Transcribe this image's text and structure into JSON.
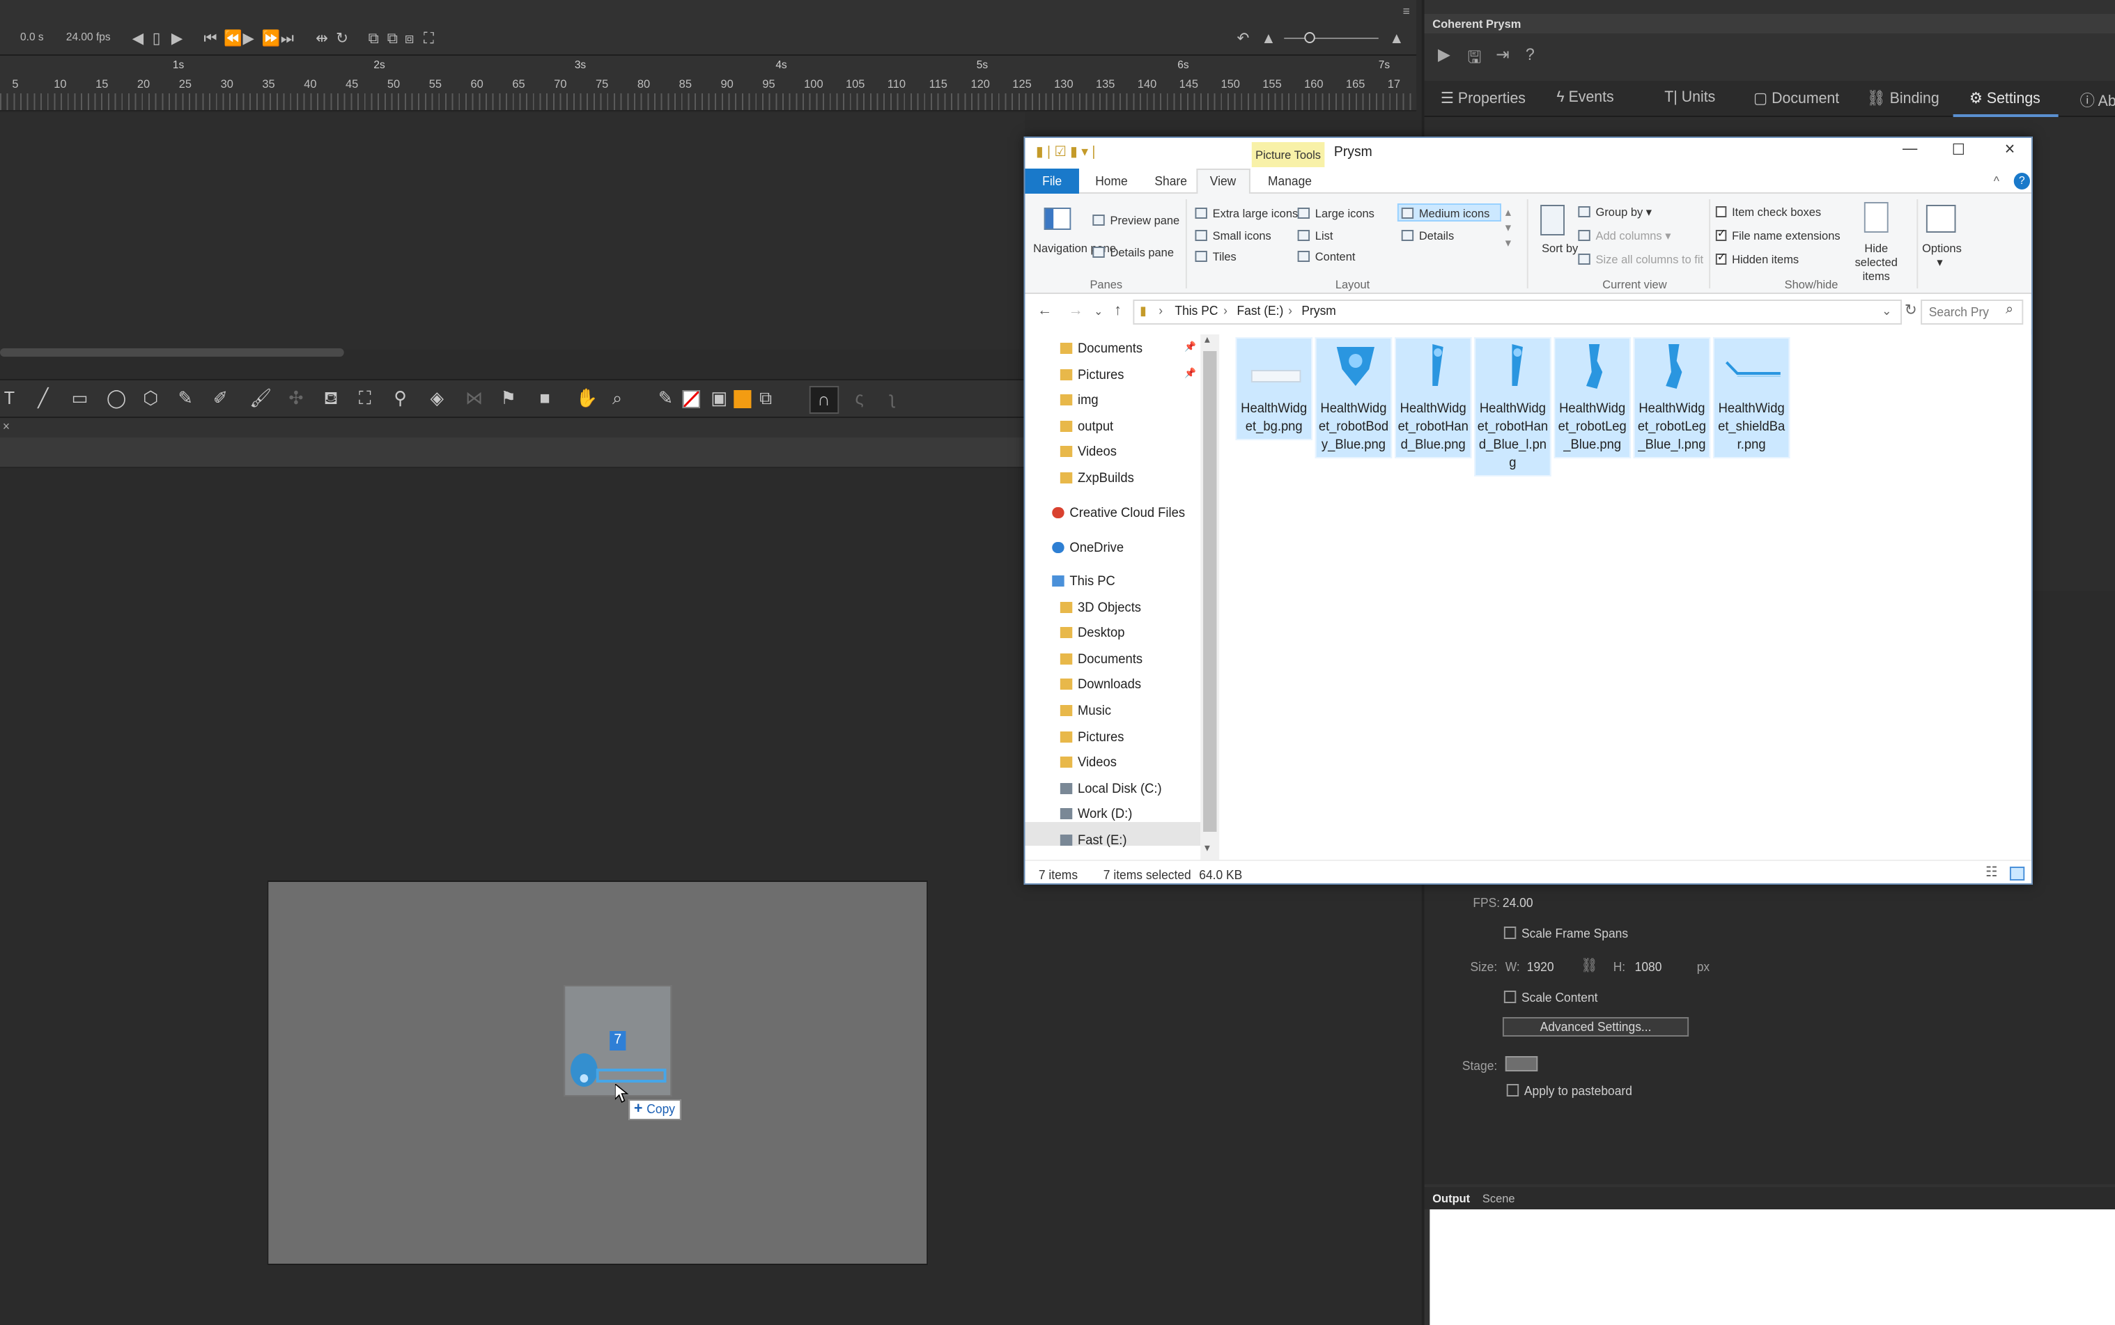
{
  "timeline": {
    "time": "0.0 s",
    "fps": "24.00 fps",
    "seconds": [
      "1s",
      "2s",
      "3s",
      "4s",
      "5s",
      "6s",
      "7s"
    ],
    "frames": [
      "5",
      "10",
      "15",
      "20",
      "25",
      "30",
      "35",
      "40",
      "45",
      "50",
      "55",
      "60",
      "65",
      "70",
      "75",
      "80",
      "85",
      "90",
      "95",
      "100",
      "105",
      "110",
      "115",
      "120",
      "125",
      "130",
      "135",
      "140",
      "145",
      "150",
      "155",
      "160",
      "165",
      "17"
    ]
  },
  "stage": {
    "drag_badge": "7",
    "copy_tooltip": "Copy"
  },
  "right_panel": {
    "title": "Coherent Prysm",
    "tabs": [
      {
        "label": "Properties",
        "icon": "sliders-icon"
      },
      {
        "label": "Events",
        "icon": "lightning-icon"
      },
      {
        "label": "Units",
        "icon": "text-icon"
      },
      {
        "label": "Document",
        "icon": "document-icon"
      },
      {
        "label": "Binding",
        "icon": "link-icon"
      },
      {
        "label": "Settings",
        "icon": "gear-icon"
      },
      {
        "label": "Ab",
        "icon": "info-icon"
      }
    ],
    "active_tab": "Settings",
    "fps_label": "FPS:",
    "fps_value": "24.00",
    "scale_frame_spans": "Scale Frame Spans",
    "size_label": "Size:",
    "w_label": "W:",
    "w_value": "1920",
    "h_label": "H:",
    "h_value": "1080",
    "unit": "px",
    "scale_content": "Scale Content",
    "advanced_button": "Advanced Settings...",
    "stage_label": "Stage:",
    "stage_color": "#6e6e6e",
    "apply_pasteboard": "Apply to pasteboard",
    "output_tabs": [
      "Output",
      "Scene"
    ]
  },
  "explorer": {
    "title": "Prysm",
    "picture_tools": "Picture Tools",
    "tabs": {
      "file": "File",
      "home": "Home",
      "share": "Share",
      "view": "View",
      "manage": "Manage"
    },
    "ribbon": {
      "navigation_pane": "Navigation pane",
      "preview_pane": "Preview pane",
      "details_pane": "Details pane",
      "panes_group": "Panes",
      "layout": [
        "Extra large icons",
        "Large icons",
        "Medium icons",
        "Small icons",
        "List",
        "Details",
        "Tiles",
        "Content"
      ],
      "layout_group": "Layout",
      "sort_by": "Sort by",
      "group_by": "Group by",
      "add_columns": "Add columns",
      "size_columns": "Size all columns to fit",
      "current_view_group": "Current view",
      "item_check_boxes": "Item check boxes",
      "file_name_extensions": "File name extensions",
      "hidden_items": "Hidden items",
      "hide_selected": "Hide selected items",
      "show_hide_group": "Show/hide",
      "options": "Options"
    },
    "breadcrumb": [
      "This PC",
      "Fast (E:)",
      "Prysm"
    ],
    "search_placeholder": "Search Pry",
    "nav_items": [
      {
        "label": "Documents",
        "type": "folder",
        "pinned": true
      },
      {
        "label": "Pictures",
        "type": "folder",
        "pinned": true
      },
      {
        "label": "img",
        "type": "folder"
      },
      {
        "label": "output",
        "type": "folder"
      },
      {
        "label": "Videos",
        "type": "folder"
      },
      {
        "label": "ZxpBuilds",
        "type": "folder"
      },
      {
        "label": "Creative Cloud Files",
        "type": "cloud"
      },
      {
        "label": "OneDrive",
        "type": "onedrive"
      },
      {
        "label": "This PC",
        "type": "pc"
      },
      {
        "label": "3D Objects",
        "type": "folder"
      },
      {
        "label": "Desktop",
        "type": "folder"
      },
      {
        "label": "Documents",
        "type": "folder"
      },
      {
        "label": "Downloads",
        "type": "folder"
      },
      {
        "label": "Music",
        "type": "folder"
      },
      {
        "label": "Pictures",
        "type": "folder"
      },
      {
        "label": "Videos",
        "type": "folder"
      },
      {
        "label": "Local Disk (C:)",
        "type": "drive"
      },
      {
        "label": "Work (D:)",
        "type": "drive"
      },
      {
        "label": "Fast (E:)",
        "type": "drive"
      }
    ],
    "files": [
      {
        "name": "HealthWidget_bg.png",
        "art": "bg"
      },
      {
        "name": "HealthWidget_robotBody_Blue.png",
        "art": "body"
      },
      {
        "name": "HealthWidget_robotHand_Blue.png",
        "art": "hand"
      },
      {
        "name": "HealthWidget_robotHand_Blue_l.png",
        "art": "hand"
      },
      {
        "name": "HealthWidget_robotLeg_Blue.png",
        "art": "leg"
      },
      {
        "name": "HealthWidget_robotLeg_Blue_l.png",
        "art": "leg"
      },
      {
        "name": "HealthWidget_shieldBar.png",
        "art": "shield"
      }
    ],
    "status": {
      "items": "7 items",
      "selected": "7 items selected",
      "size": "64.0 KB"
    }
  }
}
